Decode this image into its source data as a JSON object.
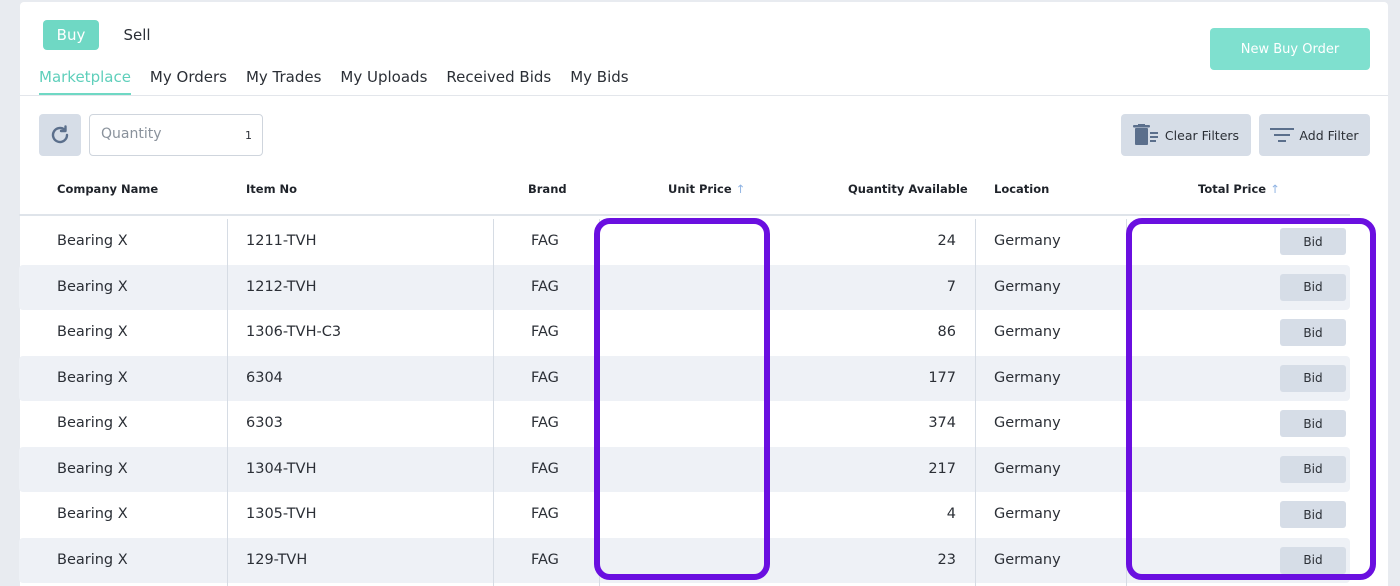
{
  "mode": {
    "buy_label": "Buy",
    "sell_label": "Sell"
  },
  "actions": {
    "new_order_label": "New Buy Order"
  },
  "tabs": [
    "Marketplace",
    "My Orders",
    "My Trades",
    "My Uploads",
    "Received Bids",
    "My Bids"
  ],
  "active_tab": "Marketplace",
  "toolbar": {
    "refresh_icon": "refresh-icon",
    "quantity_label": "Quantity",
    "quantity_value": "1",
    "clear_filters_label": "Clear Filters",
    "add_filter_label": "Add Filter"
  },
  "table": {
    "headers": {
      "company": "Company Name",
      "item": "Item No",
      "brand": "Brand",
      "unit_price": "Unit Price",
      "quantity": "Quantity Available",
      "location": "Location",
      "total_price": "Total Price"
    },
    "sort_arrow": "↑",
    "bid_label": "Bid",
    "rows": [
      {
        "company": "Bearing X",
        "item": "1211-TVH",
        "brand": "FAG",
        "quantity": "24",
        "location": "Germany"
      },
      {
        "company": "Bearing X",
        "item": "1212-TVH",
        "brand": "FAG",
        "quantity": "7",
        "location": "Germany"
      },
      {
        "company": "Bearing X",
        "item": "1306-TVH-C3",
        "brand": "FAG",
        "quantity": "86",
        "location": "Germany"
      },
      {
        "company": "Bearing X",
        "item": "6304",
        "brand": "FAG",
        "quantity": "177",
        "location": "Germany"
      },
      {
        "company": "Bearing X",
        "item": "6303",
        "brand": "FAG",
        "quantity": "374",
        "location": "Germany"
      },
      {
        "company": "Bearing X",
        "item": "1304-TVH",
        "brand": "FAG",
        "quantity": "217",
        "location": "Germany"
      },
      {
        "company": "Bearing X",
        "item": "1305-TVH",
        "brand": "FAG",
        "quantity": "4",
        "location": "Germany"
      },
      {
        "company": "Bearing X",
        "item": "129-TVH",
        "brand": "FAG",
        "quantity": "23",
        "location": "Germany"
      }
    ]
  },
  "colors": {
    "accent": "#6fd8c4",
    "highlight": "#6a0fe0",
    "row_alt": "#eef1f6",
    "button_gray": "#d6dde7"
  }
}
